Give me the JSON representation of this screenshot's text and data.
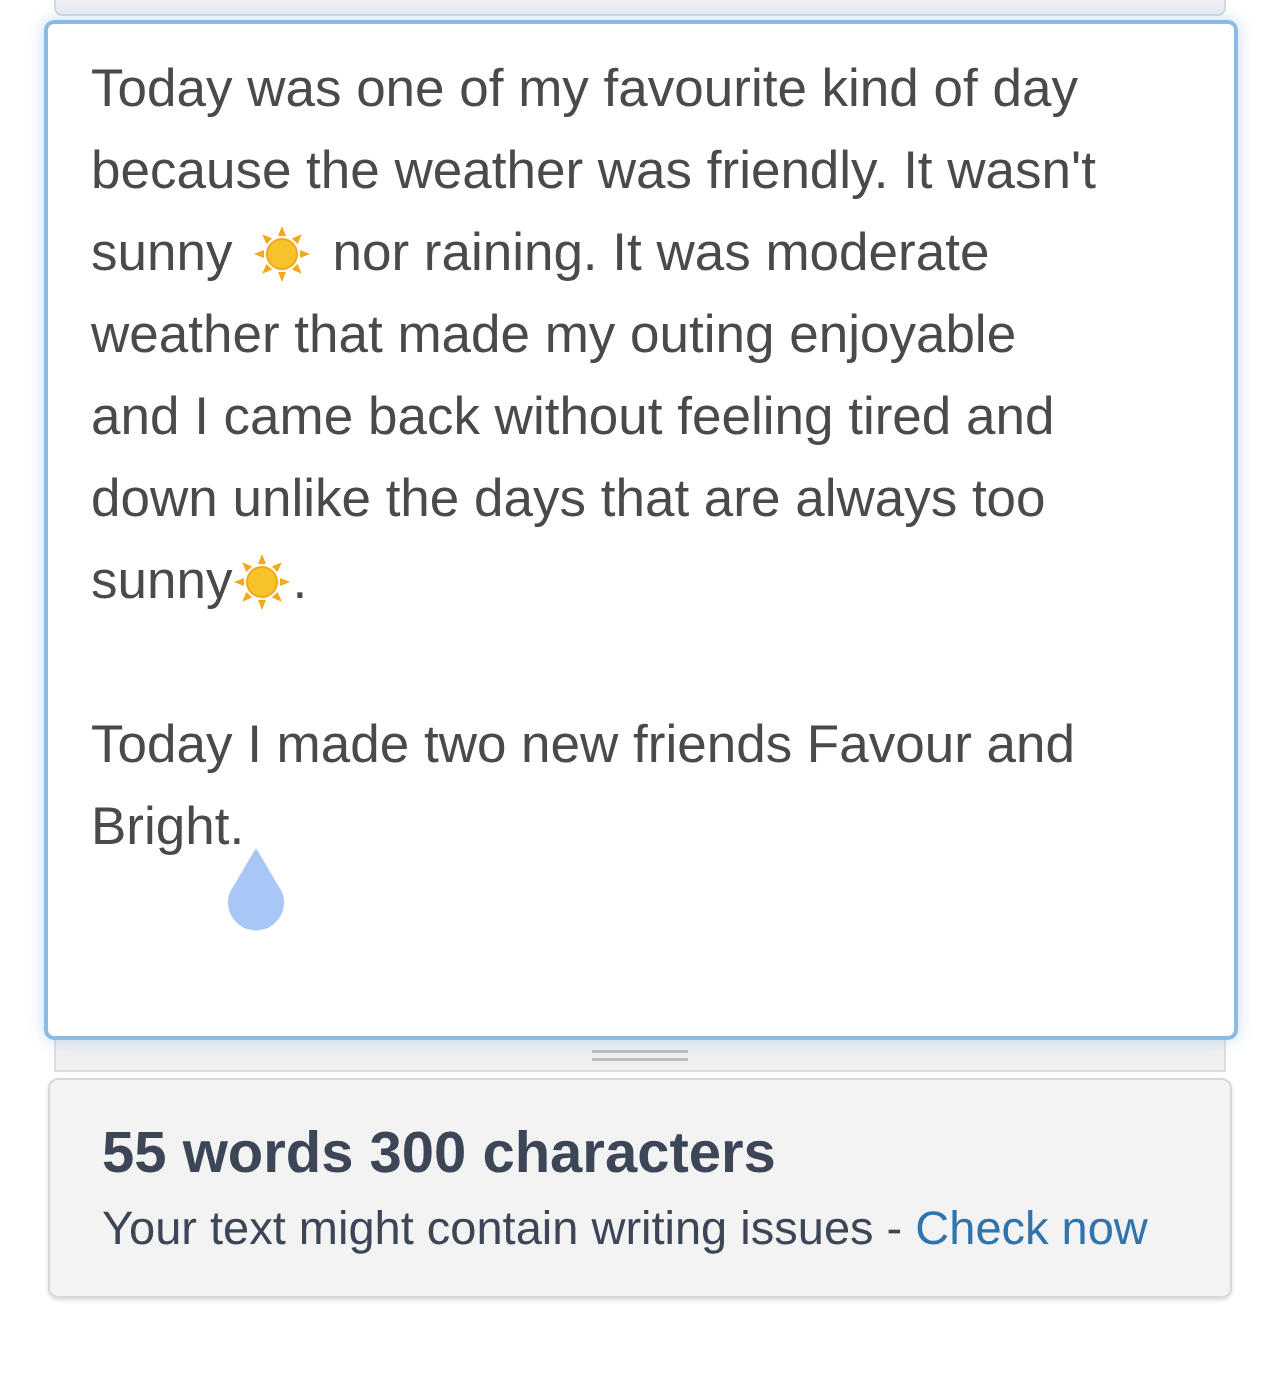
{
  "editor": {
    "paragraphs": [
      {
        "lines": [
          [
            {
              "kind": "text",
              "text": "Today was one of my favourite kind of day"
            }
          ],
          [
            {
              "kind": "text",
              "text": "because the weather was friendly. It wasn't"
            }
          ],
          [
            {
              "kind": "text",
              "text": "sunny"
            },
            {
              "kind": "sun"
            },
            {
              "kind": "text",
              "text": "nor raining. It was moderate"
            }
          ],
          [
            {
              "kind": "text",
              "text": "weather that made my outing enjoyable"
            }
          ],
          [
            {
              "kind": "text",
              "text": "and I came back without feeling tired and"
            }
          ],
          [
            {
              "kind": "text",
              "text": "down unlike the days that are always too"
            }
          ],
          [
            {
              "kind": "text",
              "text": "sunny"
            },
            {
              "kind": "sun"
            },
            {
              "kind": "text",
              "text": "."
            }
          ]
        ]
      },
      {
        "lines": [
          [
            {
              "kind": "text",
              "text": "Today I made two new friends Favour and"
            }
          ],
          [
            {
              "kind": "text",
              "text": "Bright."
            }
          ]
        ]
      }
    ]
  },
  "stats": {
    "title": "55 words 300 characters",
    "message": "Your text might contain writing issues - ",
    "link": "Check now"
  }
}
